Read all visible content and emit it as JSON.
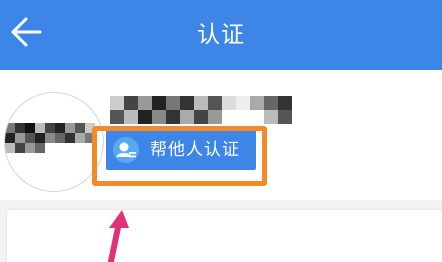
{
  "header": {
    "title": "认证",
    "back_icon": "arrow-left-icon",
    "background_color": "#3d86e8"
  },
  "profile": {
    "help_button_label": "帮他人认证",
    "help_button_icon": "user-certify-icon",
    "button_color": "#3d86e8",
    "highlight_color": "#f28a2a"
  },
  "annotation": {
    "arrow_color": "#e0327a"
  }
}
